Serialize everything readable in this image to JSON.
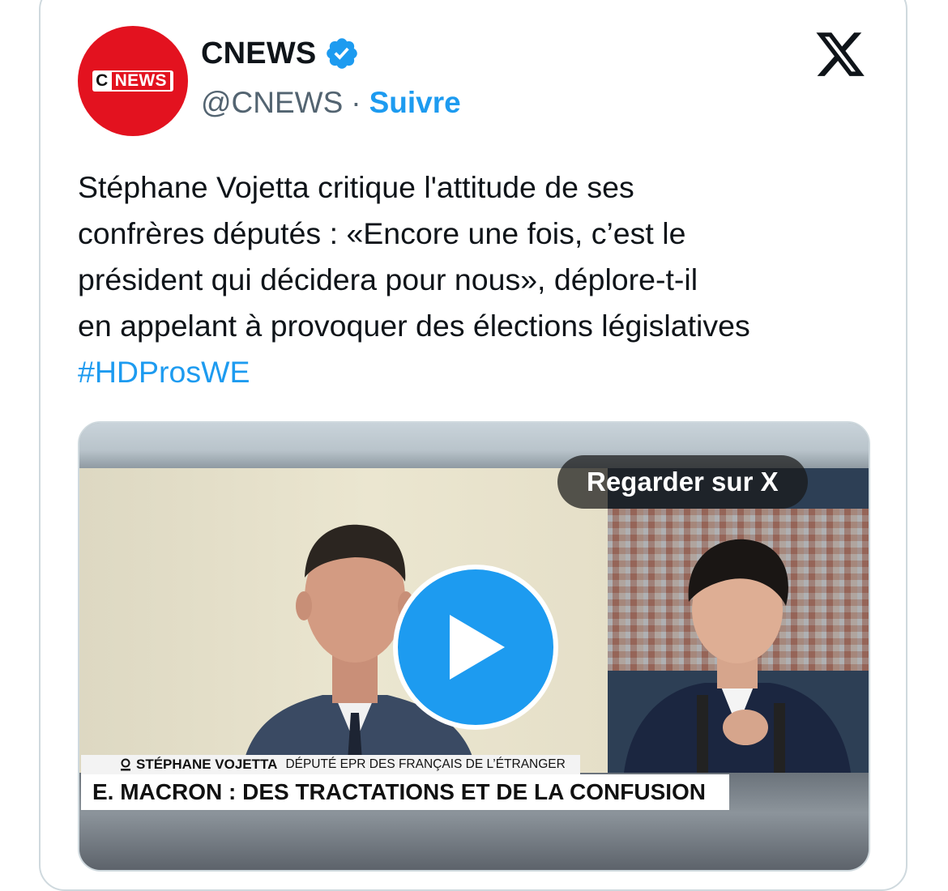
{
  "account": {
    "avatar_logo_c": "C",
    "avatar_logo_news": "NEWS",
    "display_name": "CNEWS",
    "handle": "@CNEWS",
    "separator": "·",
    "follow_label": "Suivre"
  },
  "tweet": {
    "lines": [
      "Stéphane Vojetta critique l'attitude de ses",
      "confrères députés : «Encore une fois, c’est le",
      "président qui décidera pour nous»,  déplore-t-il",
      "en appelant à provoquer des élections législatives"
    ],
    "hashtag": "#HDProsWE"
  },
  "media": {
    "watch_label": "Regarder sur X",
    "lower_third_name": "STÉPHANE VOJETTA",
    "lower_third_role": "DÉPUTÉ EPR DES FRANÇAIS DE L’ÉTRANGER",
    "headline": "E. MACRON : DES TRACTATIONS ET DE LA CONFUSION"
  },
  "colors": {
    "accent": "#1d9bf0",
    "brand_red": "#e3121f",
    "text": "#0f1419",
    "muted": "#536471",
    "border": "#cfd9de"
  },
  "icons": {
    "verified": "verified-badge-icon",
    "x": "x-logo-icon",
    "play": "play-icon",
    "pin": "location-pin-icon"
  }
}
